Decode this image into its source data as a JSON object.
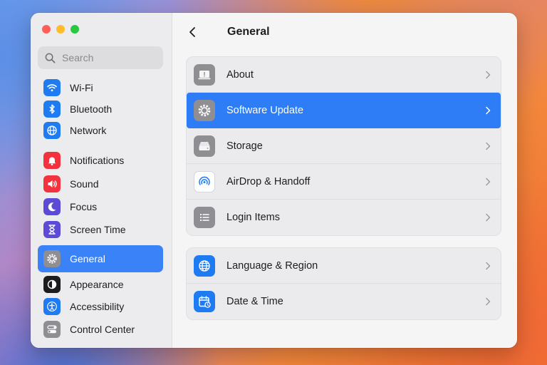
{
  "sidebar": {
    "search_placeholder": "Search",
    "items": [
      {
        "label": "Wi-Fi",
        "icon": "wifi-icon",
        "color": "#1e7bf2"
      },
      {
        "label": "Bluetooth",
        "icon": "bluetooth-icon",
        "color": "#1e7bf2"
      },
      {
        "label": "Network",
        "icon": "globe-icon",
        "color": "#1e7bf2"
      },
      {
        "label": "Notifications",
        "icon": "bell-icon",
        "color": "#f2333e"
      },
      {
        "label": "Sound",
        "icon": "speaker-icon",
        "color": "#f2333e"
      },
      {
        "label": "Focus",
        "icon": "moon-icon",
        "color": "#5b4bd6"
      },
      {
        "label": "Screen Time",
        "icon": "hourglass-icon",
        "color": "#5b4bd6"
      },
      {
        "label": "General",
        "icon": "gear-icon",
        "color": "#8e8e93",
        "selected": true
      },
      {
        "label": "Appearance",
        "icon": "appearance-icon",
        "color": "#1c1c1e"
      },
      {
        "label": "Accessibility",
        "icon": "accessibility-icon",
        "color": "#1e7bf2"
      },
      {
        "label": "Control Center",
        "icon": "toggles-icon",
        "color": "#8e8e93"
      }
    ]
  },
  "main": {
    "title": "General",
    "groups": [
      [
        {
          "label": "About",
          "icon": "about-icon",
          "color": "#8e8e93"
        },
        {
          "label": "Software Update",
          "icon": "gear-icon",
          "color": "#8e8e93",
          "selected": true
        },
        {
          "label": "Storage",
          "icon": "storage-icon",
          "color": "#8e8e93"
        },
        {
          "label": "AirDrop & Handoff",
          "icon": "airdrop-icon",
          "color": "#ffffff"
        },
        {
          "label": "Login Items",
          "icon": "list-icon",
          "color": "#8e8e93"
        }
      ],
      [
        {
          "label": "Language & Region",
          "icon": "globe-icon",
          "color": "#1e7bf2"
        },
        {
          "label": "Date & Time",
          "icon": "calendar-icon",
          "color": "#1e7bf2"
        }
      ]
    ]
  },
  "colors": {
    "accent": "#2f7df6",
    "sidebar_bg": "#ececee",
    "content_bg": "#f5f5f6"
  }
}
